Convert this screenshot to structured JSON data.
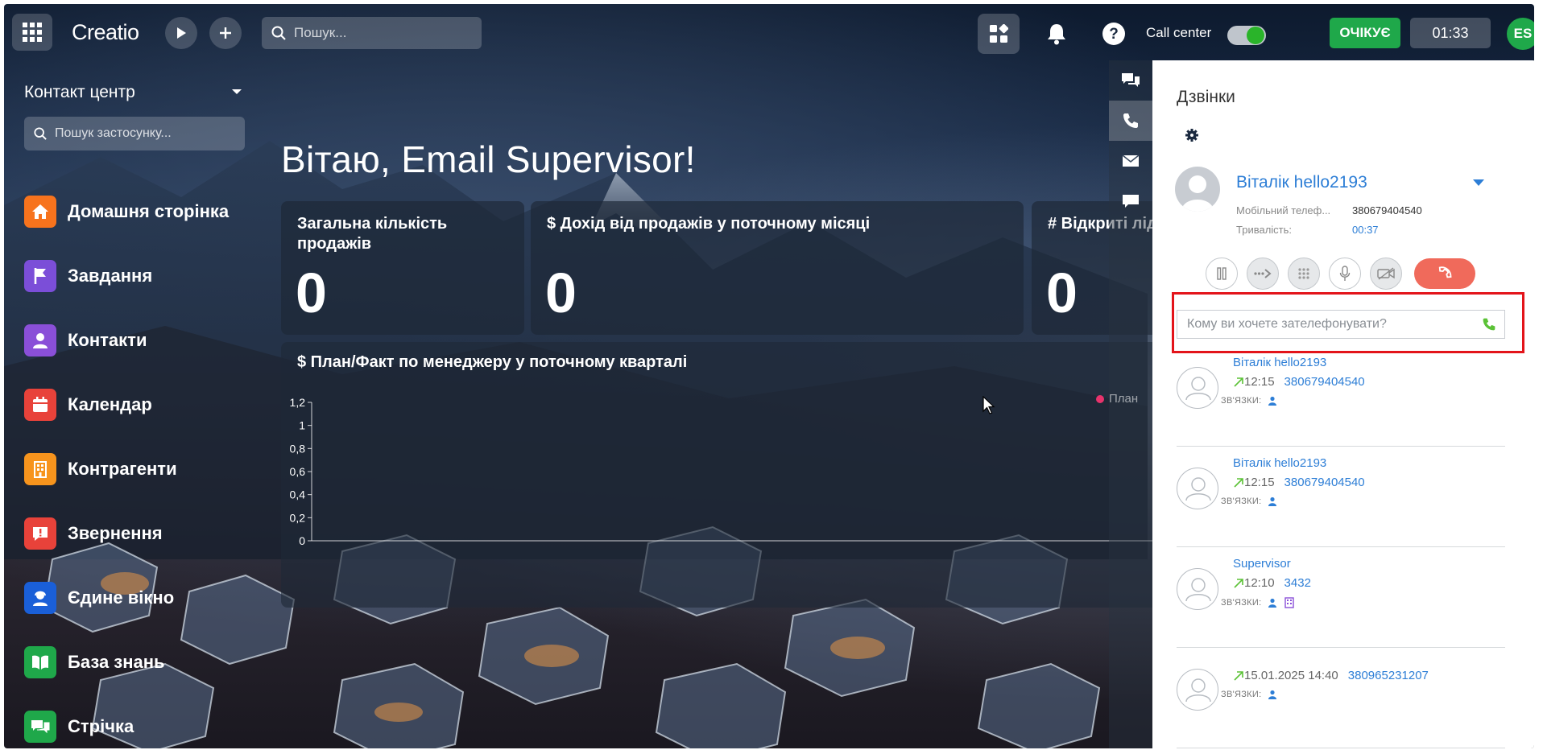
{
  "topbar": {
    "logo": "Creatio",
    "search_placeholder": "Пошук...",
    "call_center_label": "Call center",
    "status_label": "ОЧІКУЄ",
    "timer": "01:33",
    "user_initials": "ES"
  },
  "sidebar": {
    "workspace_title": "Контакт центр",
    "app_search_placeholder": "Пошук застосунку...",
    "items": [
      {
        "label": "Домашня сторінка",
        "icon": "home-icon",
        "color": "#f7731d"
      },
      {
        "label": "Завдання",
        "icon": "flag-icon",
        "color": "#7b4ed8"
      },
      {
        "label": "Контакти",
        "icon": "person-icon",
        "color": "#8a4fd8"
      },
      {
        "label": "Календар",
        "icon": "calendar-icon",
        "color": "#e8423a"
      },
      {
        "label": "Контрагенти",
        "icon": "building-icon",
        "color": "#f7941d"
      },
      {
        "label": "Звернення",
        "icon": "alert-bubble-icon",
        "color": "#e8423a"
      },
      {
        "label": "Єдине вікно",
        "icon": "agent-icon",
        "color": "#1a5fd8"
      },
      {
        "label": "База знань",
        "icon": "book-icon",
        "color": "#1fa84a"
      },
      {
        "label": "Стрічка",
        "icon": "feed-icon",
        "color": "#1fa84a"
      }
    ]
  },
  "dashboard": {
    "greeting": "Вітаю, Email Supervisor!",
    "kpis": [
      {
        "title": "Загальна кількість продажів",
        "value": "0"
      },
      {
        "title": "$ Дохід від продажів у поточному місяці",
        "value": "0"
      },
      {
        "title": "# Відкриті ліди",
        "value": "0"
      }
    ],
    "chart_title": "$ План/Факт по менеджеру у поточному кварталі"
  },
  "chart_data": {
    "type": "bar",
    "title": "$ План/Факт по менеджеру у поточному кварталі",
    "categories": [],
    "series": [
      {
        "name": "План",
        "values": []
      }
    ],
    "y_ticks": [
      "0",
      "0,2",
      "0,4",
      "0,6",
      "0,8",
      "1",
      "1,2"
    ],
    "ylim": [
      0,
      1.2
    ],
    "legend_position": "top-right",
    "colors": {
      "План": "#e8336c"
    }
  },
  "call_panel": {
    "title": "Дзвінки",
    "current": {
      "name": "Віталік hello2193",
      "phone_label": "Мобільний телеф...",
      "phone": "380679404540",
      "duration_label": "Тривалість:",
      "duration": "00:37"
    },
    "dial_placeholder": "Кому ви хочете зателефонувати?",
    "links_label": "ЗВ'ЯЗКИ:",
    "history": [
      {
        "name": "Віталік hello2193",
        "time": "12:15",
        "number": "380679404540",
        "links": [
          "contact"
        ]
      },
      {
        "name": "Віталік hello2193",
        "time": "12:15",
        "number": "380679404540",
        "links": [
          "contact"
        ]
      },
      {
        "name": "Supervisor",
        "time": "12:10",
        "number": "3432",
        "links": [
          "contact",
          "account"
        ]
      },
      {
        "name": "",
        "time": "15.01.2025 14:40",
        "number": "380965231207",
        "links": [
          "contact"
        ]
      }
    ]
  },
  "colors": {
    "accent_blue": "#2d7ed6",
    "status_green": "#1fa84a",
    "hangup_red": "#f06a5b",
    "highlight_red": "#e3141a"
  }
}
